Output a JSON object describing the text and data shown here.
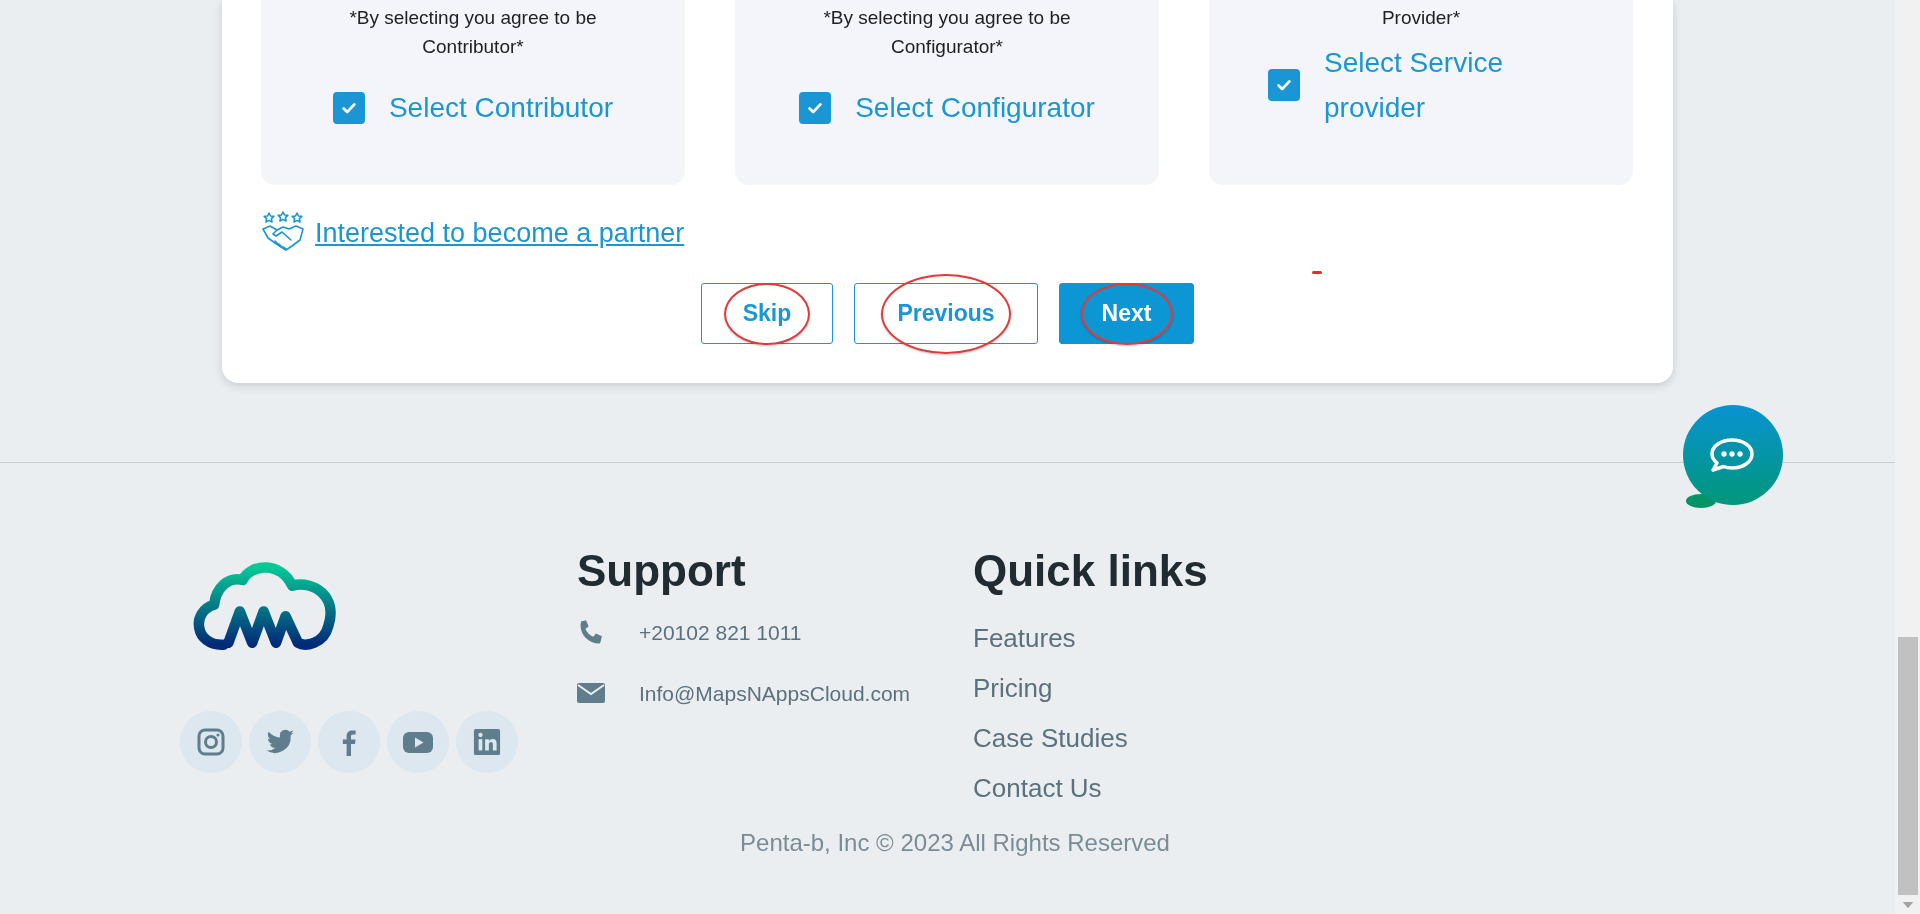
{
  "role_cards": [
    {
      "note_lines": [
        "*By selecting you agree to be",
        "Contributor*"
      ],
      "checkbox_label": "Select Contributor",
      "checked": true
    },
    {
      "note_lines": [
        "*By selecting you agree to be",
        "Configurator*"
      ],
      "checkbox_label": "Select Configurator",
      "checked": true
    },
    {
      "note_lines": [
        "Provider*"
      ],
      "checkbox_label": "Select Service provider",
      "checked": true
    }
  ],
  "partner_link": "Interested to become a partner",
  "buttons": [
    {
      "label": "Skip",
      "kind": "outline",
      "circled": true
    },
    {
      "label": "Previous",
      "kind": "outline",
      "circled": true
    },
    {
      "label": "Next",
      "kind": "primary",
      "circled": true
    }
  ],
  "footer": {
    "social": [
      {
        "kind": "instagram"
      },
      {
        "kind": "twitter"
      },
      {
        "kind": "facebook"
      },
      {
        "kind": "youtube"
      },
      {
        "kind": "linkedin"
      }
    ],
    "support": {
      "heading": "Support",
      "contacts": [
        {
          "kind": "phone",
          "text": "+20102 821 1011"
        },
        {
          "kind": "email",
          "text": "Info@MapsNAppsCloud.com"
        }
      ]
    },
    "quick_links": {
      "heading": "Quick links",
      "links": [
        "Features",
        "Pricing",
        "Case Studies",
        "Contact Us"
      ]
    },
    "copyright": "Penta-b, Inc © 2023 All Rights Reserved"
  }
}
